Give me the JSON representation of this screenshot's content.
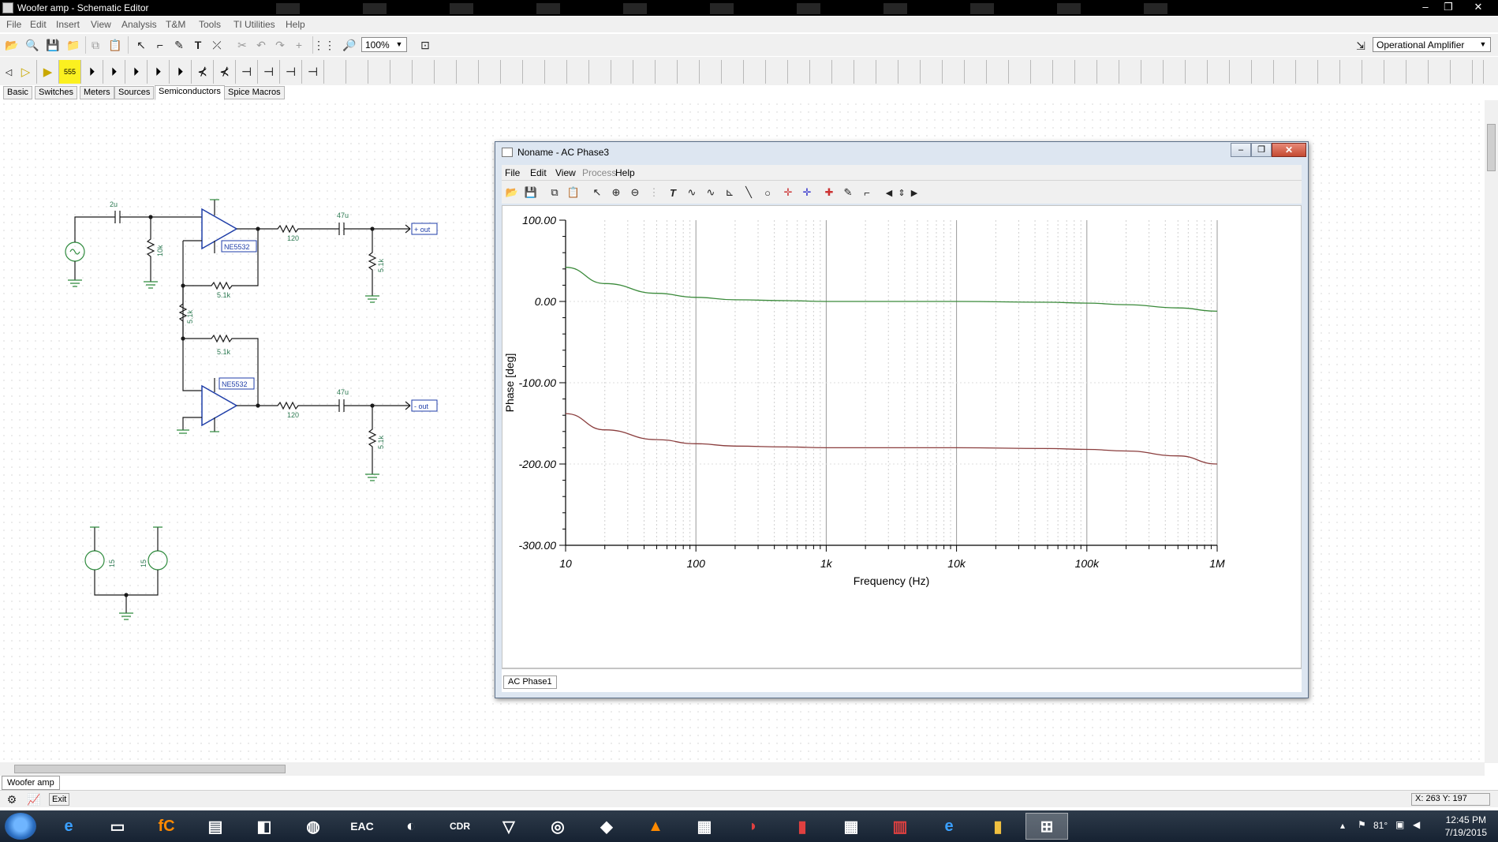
{
  "window": {
    "title": "Woofer amp - Schematic Editor",
    "minimize": "–",
    "restore": "❐",
    "close": "✕"
  },
  "menu": [
    "File",
    "Edit",
    "Insert",
    "View",
    "Analysis",
    "T&M",
    "Tools",
    "TI Utilities",
    "Help"
  ],
  "toolbar": {
    "zoom": "100%",
    "component_select": "Operational Amplifier"
  },
  "component_tabs": [
    "Basic",
    "Switches",
    "Meters",
    "Sources",
    "Semiconductors",
    "Spice Macros"
  ],
  "active_component_tab": "Semiconductors",
  "schematic": {
    "c_in": "2u",
    "r_in": "10k",
    "opamp1": "NE5532",
    "opamp2": "NE5532",
    "r_out1": "120",
    "c_out1": "47u",
    "r_load1": "5.1k",
    "r_fb1": "5.1k",
    "r_mid": "5.1k",
    "r_fb2": "5.1k",
    "r_out2": "120",
    "c_out2": "47u",
    "r_load2": "5.1k",
    "out_pos": "+ out",
    "out_neg": "- out",
    "vsup1": "15",
    "vsup2": "15"
  },
  "document_tab": "Woofer amp",
  "statusbar": {
    "coords": "X: 263 Y: 197",
    "exit": "Exit"
  },
  "ac_window": {
    "title": "Noname - AC Phase3",
    "menu": [
      "File",
      "Edit",
      "View",
      "Process",
      "Help"
    ],
    "tab": "AC Phase1",
    "minimize": "–",
    "restore": "❐",
    "close": "✕"
  },
  "chart_data": {
    "type": "line",
    "title": "",
    "xlabel": "Frequency (Hz)",
    "ylabel": "Phase [deg]",
    "xscale": "log",
    "xlim": [
      10,
      1000000
    ],
    "ylim": [
      -300,
      100
    ],
    "x_tick_labels": [
      "10",
      "100",
      "1k",
      "10k",
      "100k",
      "1M"
    ],
    "y_tick_labels": [
      "100.00",
      "0.00",
      "-100.00",
      "-200.00",
      "-300.00"
    ],
    "grid": true,
    "series": [
      {
        "color": "#3a8a3a",
        "x": [
          10,
          20,
          50,
          100,
          200,
          500,
          1000,
          10000,
          50000,
          100000,
          200000,
          500000,
          1000000
        ],
        "values": [
          42,
          22,
          10,
          5,
          2,
          1,
          0,
          0,
          -1,
          -2,
          -4,
          -8,
          -12
        ]
      },
      {
        "color": "#8a3d3d",
        "x": [
          10,
          20,
          50,
          100,
          200,
          500,
          1000,
          10000,
          50000,
          100000,
          200000,
          500000,
          1000000
        ],
        "values": [
          -138,
          -158,
          -170,
          -175,
          -178,
          -179,
          -180,
          -180,
          -181,
          -182,
          -184,
          -190,
          -200
        ]
      }
    ]
  },
  "taskbar": {
    "time": "12:45 PM",
    "date": "7/19/2015",
    "temp": "81°"
  }
}
